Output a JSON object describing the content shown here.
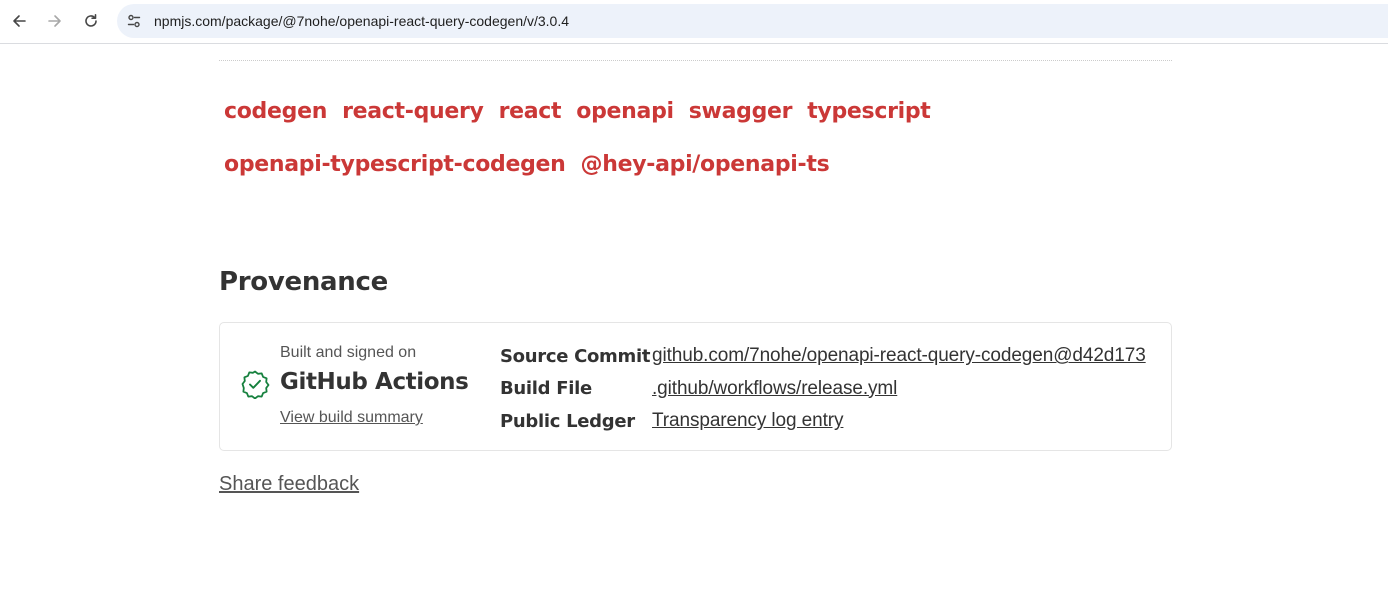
{
  "browser": {
    "url": "npmjs.com/package/@7nohe/openapi-react-query-codegen/v/3.0.4"
  },
  "keywords": {
    "row1": [
      "codegen",
      "react-query",
      "react",
      "openapi",
      "swagger",
      "typescript"
    ],
    "row2": [
      "openapi-typescript-codegen",
      "@hey-api/openapi-ts"
    ],
    "color": "#cb3837"
  },
  "provenance": {
    "heading": "Provenance",
    "built_on_label": "Built and signed on",
    "ci_name": "GitHub Actions",
    "build_summary_link": "View build summary",
    "rows": [
      {
        "label": "Source Commit",
        "value": "github.com/7nohe/openapi-react-query-codegen@d42d173"
      },
      {
        "label": "Build File",
        "value": ".github/workflows/release.yml"
      },
      {
        "label": "Public Ledger",
        "value": "Transparency log entry"
      }
    ],
    "verified_color": "#15803d"
  },
  "share_feedback": "Share feedback"
}
